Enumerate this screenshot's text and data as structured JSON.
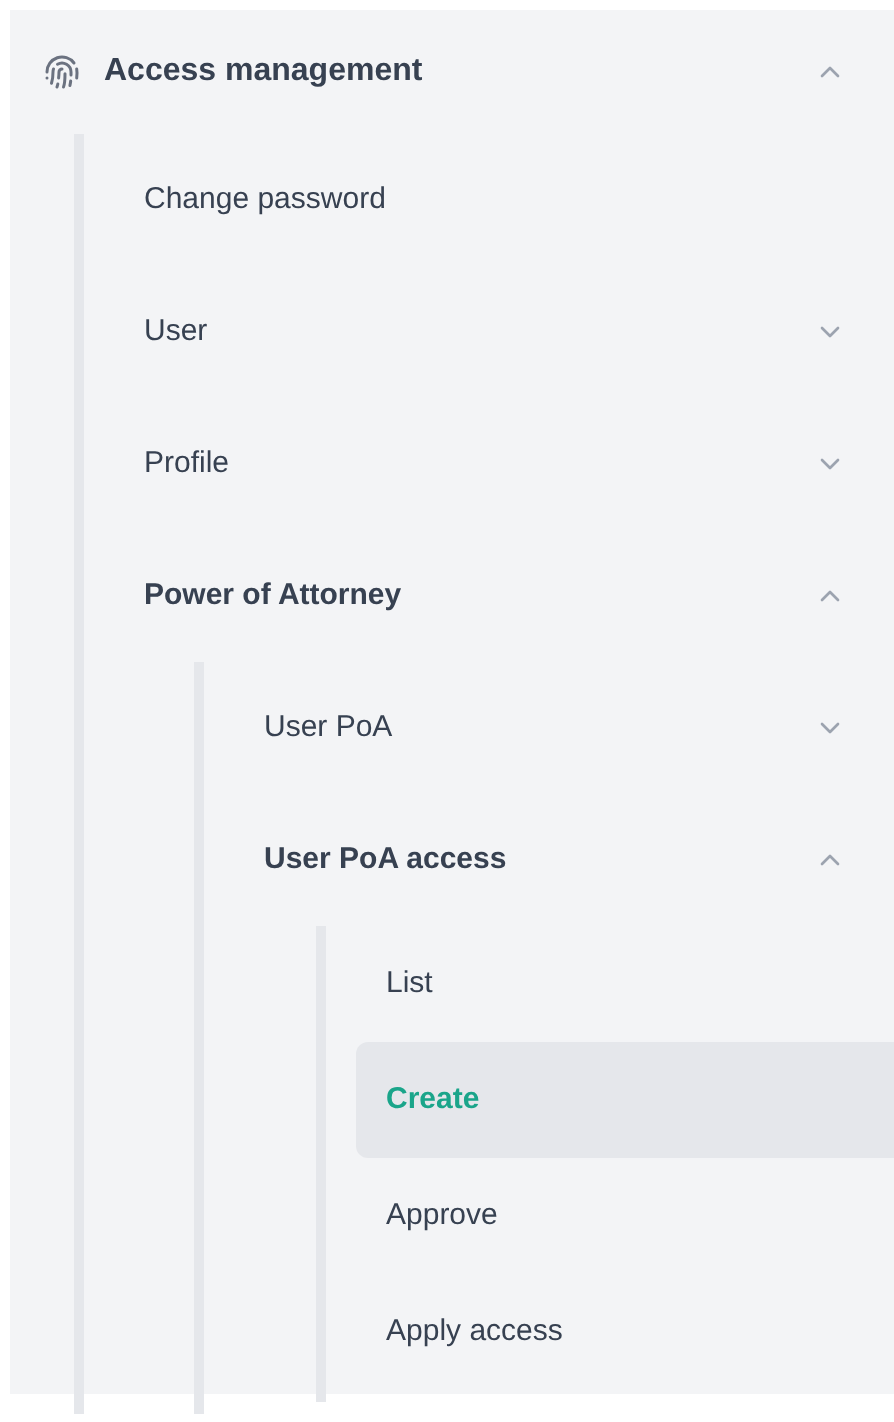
{
  "menu": {
    "title": "Access management",
    "expanded": true,
    "items": [
      {
        "label": "Change password",
        "selected": false
      },
      {
        "label": "User",
        "selected": false,
        "expanded": false
      },
      {
        "label": "Profile",
        "selected": false,
        "expanded": false
      },
      {
        "label": "Power of Attorney",
        "selected": false,
        "expanded": true,
        "children": [
          {
            "label": "User PoA",
            "selected": false,
            "expanded": false
          },
          {
            "label": "User PoA access",
            "selected": false,
            "expanded": true,
            "children": [
              {
                "label": "List",
                "selected": false
              },
              {
                "label": "Create",
                "selected": true
              },
              {
                "label": "Approve",
                "selected": false
              },
              {
                "label": "Apply access",
                "selected": false
              }
            ]
          }
        ]
      }
    ]
  }
}
